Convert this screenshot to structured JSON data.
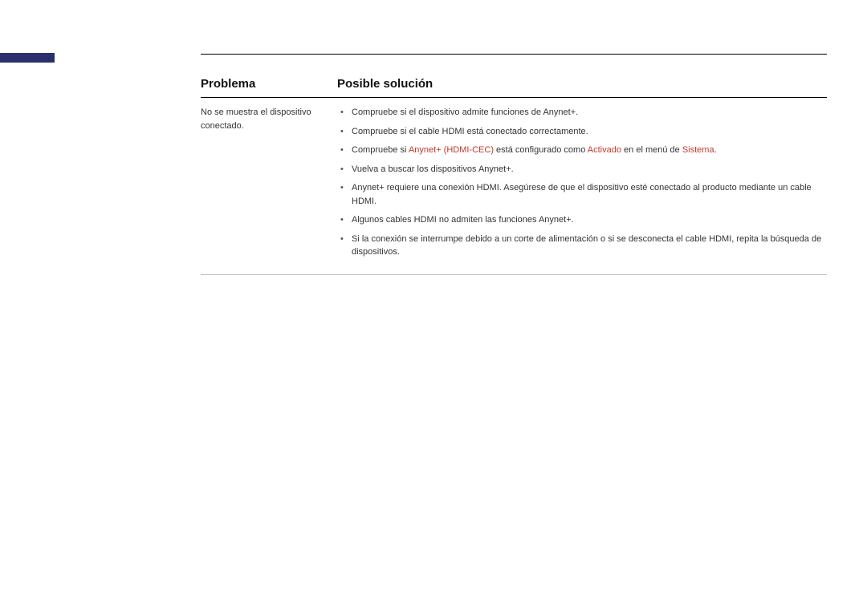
{
  "headers": {
    "problem": "Problema",
    "solution": "Posible solución"
  },
  "row": {
    "problem_text": "No se muestra el dispositivo conectado.",
    "solutions": {
      "s0": "Compruebe si el dispositivo admite funciones de Anynet+.",
      "s1": "Compruebe si el cable HDMI está conectado correctamente.",
      "s2": {
        "pre": "Compruebe si ",
        "hl1": "Anynet+ (HDMI-CEC)",
        "mid": " está configurado como ",
        "hl2": "Activado",
        "mid2": " en el menú de ",
        "hl3": "Sistema",
        "post": "."
      },
      "s3": "Vuelva a buscar los dispositivos Anynet+.",
      "s4": "Anynet+ requiere una conexión HDMI. Asegúrese de que el dispositivo esté conectado al producto mediante un cable HDMI.",
      "s5": "Algunos cables HDMI no admiten las funciones Anynet+.",
      "s6": "Si la conexión se interrumpe debido a un corte de alimentación o si se desconecta el cable HDMI, repita la búsqueda de dispositivos."
    }
  }
}
